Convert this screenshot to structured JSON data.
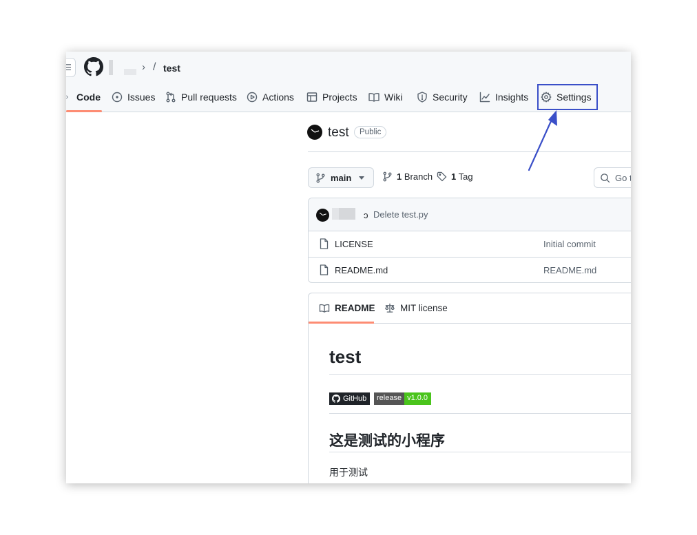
{
  "header": {
    "breadcrumb_separator": "/",
    "breadcrumb_chevron": "›",
    "repo": "test"
  },
  "nav_tabs": [
    {
      "label": "Code",
      "icon": "code-icon",
      "active": true
    },
    {
      "label": "Issues",
      "icon": "issue-opened-icon"
    },
    {
      "label": "Pull requests",
      "icon": "git-pull-request-icon"
    },
    {
      "label": "Actions",
      "icon": "play-icon"
    },
    {
      "label": "Projects",
      "icon": "table-icon"
    },
    {
      "label": "Wiki",
      "icon": "book-icon"
    },
    {
      "label": "Security",
      "icon": "shield-icon"
    },
    {
      "label": "Insights",
      "icon": "graph-icon"
    },
    {
      "label": "Settings",
      "icon": "gear-icon",
      "highlighted": true
    }
  ],
  "repo_header": {
    "name": "test",
    "visibility": "Public"
  },
  "branch_bar": {
    "branch": "main",
    "branch_count": "1",
    "branch_label": "Branch",
    "tag_count": "1",
    "tag_label": "Tag",
    "search_placeholder": "Go t"
  },
  "latest_commit": {
    "glyph": "ↄ",
    "message": "Delete test.py"
  },
  "files": [
    {
      "name": "LICENSE",
      "commit": "Initial commit"
    },
    {
      "name": "README.md",
      "commit": "README.md"
    }
  ],
  "readme": {
    "tabs": [
      {
        "label": "README",
        "icon": "book-icon",
        "active": true
      },
      {
        "label": "MIT license",
        "icon": "law-icon"
      }
    ],
    "title": "test",
    "badges": {
      "github": "GitHub",
      "release_label": "release",
      "release_version": "v1.0.0"
    },
    "heading": "这是测试的小程序",
    "paragraph": "用于测试"
  },
  "colors": {
    "accent_underline": "#fd8c73",
    "annotation": "#3a4fc8",
    "badge_green": "#4ac41c"
  }
}
